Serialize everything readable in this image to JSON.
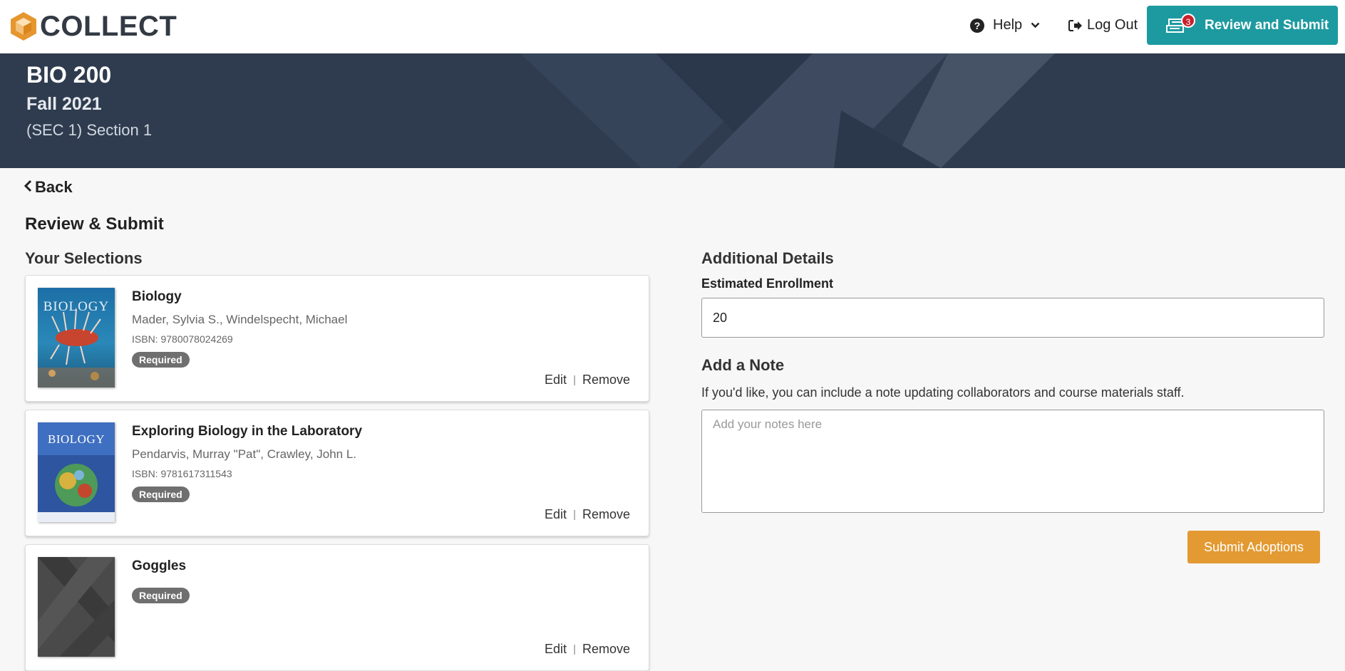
{
  "header": {
    "logo_text": "COLLECT",
    "help_label": "Help",
    "logout_label": "Log Out",
    "review_button_label": "Review and Submit",
    "cart_count": "3",
    "accent_color": "#1d9aa0"
  },
  "banner": {
    "course": "BIO 200",
    "term": "Fall 2021",
    "section": "(SEC 1) Section 1"
  },
  "page": {
    "back_label": "Back",
    "title": "Review & Submit",
    "selections_title": "Your Selections"
  },
  "selections": [
    {
      "title": "Biology",
      "authors": "Mader, Sylvia S., Windelspecht, Michael",
      "isbn": "ISBN: 9780078024269",
      "badge": "Required",
      "cover_text": "BIOLOGY",
      "edit": "Edit",
      "remove": "Remove"
    },
    {
      "title": "Exploring Biology in the Laboratory",
      "authors": "Pendarvis, Murray \"Pat\", Crawley, John L.",
      "isbn": "ISBN: 9781617311543",
      "badge": "Required",
      "cover_text": "BIOLOGY",
      "edit": "Edit",
      "remove": "Remove"
    },
    {
      "title": "Goggles",
      "badge": "Required",
      "edit": "Edit",
      "remove": "Remove"
    }
  ],
  "details": {
    "title": "Additional Details",
    "enrollment_label": "Estimated Enrollment",
    "enrollment_value": "20",
    "note_title": "Add a Note",
    "note_description": "If you'd like, you can include a note updating collaborators and course materials staff.",
    "note_placeholder": "Add your notes here",
    "submit_label": "Submit Adoptions",
    "submit_color": "#e39a32"
  }
}
